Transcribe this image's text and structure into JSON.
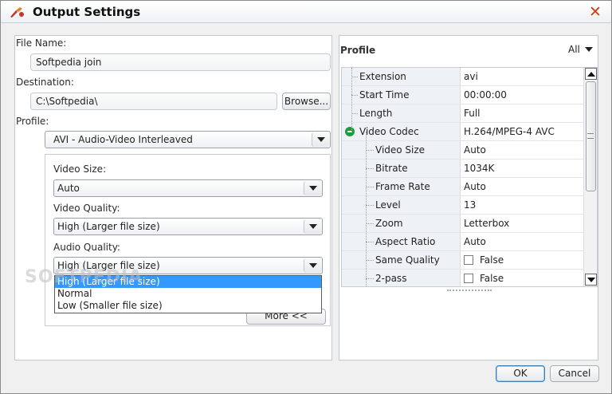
{
  "window": {
    "title": "Output Settings"
  },
  "left": {
    "file_name_label": "File Name:",
    "file_name_value": "Softpedia join",
    "destination_label": "Destination:",
    "destination_value": "C:\\Softpedia\\",
    "browse_label": "Browse...",
    "profile_label": "Profile:",
    "profile_value": "AVI - Audio-Video Interleaved",
    "video_size_label": "Video Size:",
    "video_size_value": "Auto",
    "video_quality_label": "Video Quality:",
    "video_quality_value": "High (Larger file size)",
    "audio_quality_label": "Audio Quality:",
    "audio_quality_value": "High (Larger file size)",
    "audio_quality_options": [
      "High (Larger file size)",
      "Normal",
      "Low (Smaller file size)"
    ],
    "more_label": "More <<"
  },
  "right": {
    "profile_title": "Profile",
    "filter_label": "All",
    "properties": [
      {
        "key": "Extension",
        "value": "avi"
      },
      {
        "key": "Start Time",
        "value": "00:00:00"
      },
      {
        "key": "Length",
        "value": "Full"
      },
      {
        "key": "Video Codec",
        "value": "H.264/MPEG-4 AVC"
      },
      {
        "key": "Video Size",
        "value": "Auto"
      },
      {
        "key": "Bitrate",
        "value": "1034K"
      },
      {
        "key": "Frame Rate",
        "value": "Auto"
      },
      {
        "key": "Level",
        "value": "13"
      },
      {
        "key": "Zoom",
        "value": "Letterbox"
      },
      {
        "key": "Aspect Ratio",
        "value": "Auto"
      },
      {
        "key": "Same Quality",
        "value": "False"
      },
      {
        "key": "2-pass",
        "value": "False"
      }
    ]
  },
  "footer": {
    "ok_label": "OK",
    "cancel_label": "Cancel"
  },
  "watermark": "SOFTPEDIA"
}
